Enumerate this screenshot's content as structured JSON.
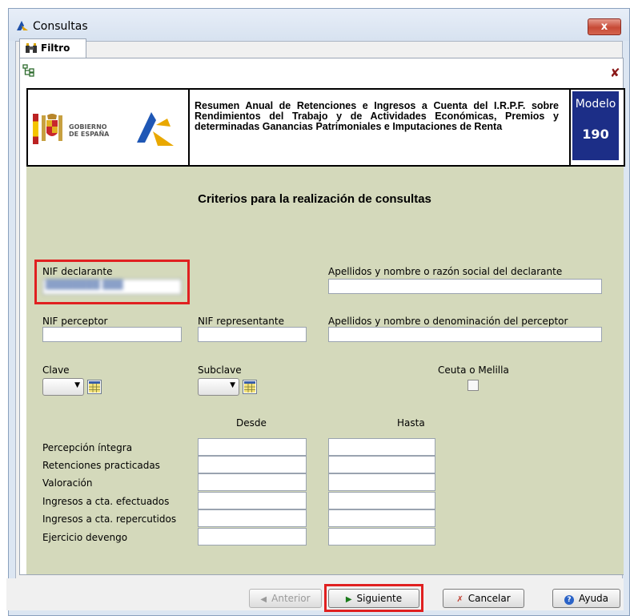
{
  "window": {
    "title": "Consultas",
    "close_label": "x"
  },
  "tab": {
    "label": "Filtro"
  },
  "header": {
    "logo_text_line1": "GOBIERNO",
    "logo_text_line2": "DE ESPAÑA",
    "description": "Resumen Anual de Retenciones e Ingresos a Cuenta del I.R.P.F. sobre Rendimientos del Trabajo y de Actividades Económicas, Premios y determinadas Ganancias Patrimoniales e Imputaciones de Renta",
    "model_label": "Modelo",
    "model_number": "190"
  },
  "form": {
    "title": "Criterios para la realización de consultas",
    "nif_declarante": {
      "label": "NIF declarante",
      "value": "████████ ███"
    },
    "apellidos_declarante": {
      "label": "Apellidos y nombre o razón social del declarante",
      "value": ""
    },
    "nif_perceptor": {
      "label": "NIF perceptor",
      "value": ""
    },
    "nif_representante": {
      "label": "NIF representante",
      "value": ""
    },
    "apellidos_perceptor": {
      "label": "Apellidos y nombre o denominación del perceptor",
      "value": ""
    },
    "clave": {
      "label": "Clave",
      "value": ""
    },
    "subclave": {
      "label": "Subclave",
      "value": ""
    },
    "ceuta": {
      "label": "Ceuta o Melilla",
      "checked": false
    },
    "range_headers": {
      "from": "Desde",
      "to": "Hasta"
    },
    "ranges": [
      {
        "label": "Percepción íntegra",
        "from": "",
        "to": ""
      },
      {
        "label": "Retenciones practicadas",
        "from": "",
        "to": ""
      },
      {
        "label": "Valoración",
        "from": "",
        "to": ""
      },
      {
        "label": "Ingresos a cta. efectuados",
        "from": "",
        "to": ""
      },
      {
        "label": "Ingresos a cta. repercutidos",
        "from": "",
        "to": ""
      },
      {
        "label": "Ejercicio devengo",
        "from": "",
        "to": ""
      }
    ]
  },
  "buttons": {
    "previous": "Anterior",
    "next": "Siguiente",
    "cancel": "Cancelar",
    "help": "Ayuda"
  },
  "colors": {
    "form_background": "#d4d9bb",
    "model_background": "#1c2e87",
    "highlight": "#e02020"
  }
}
